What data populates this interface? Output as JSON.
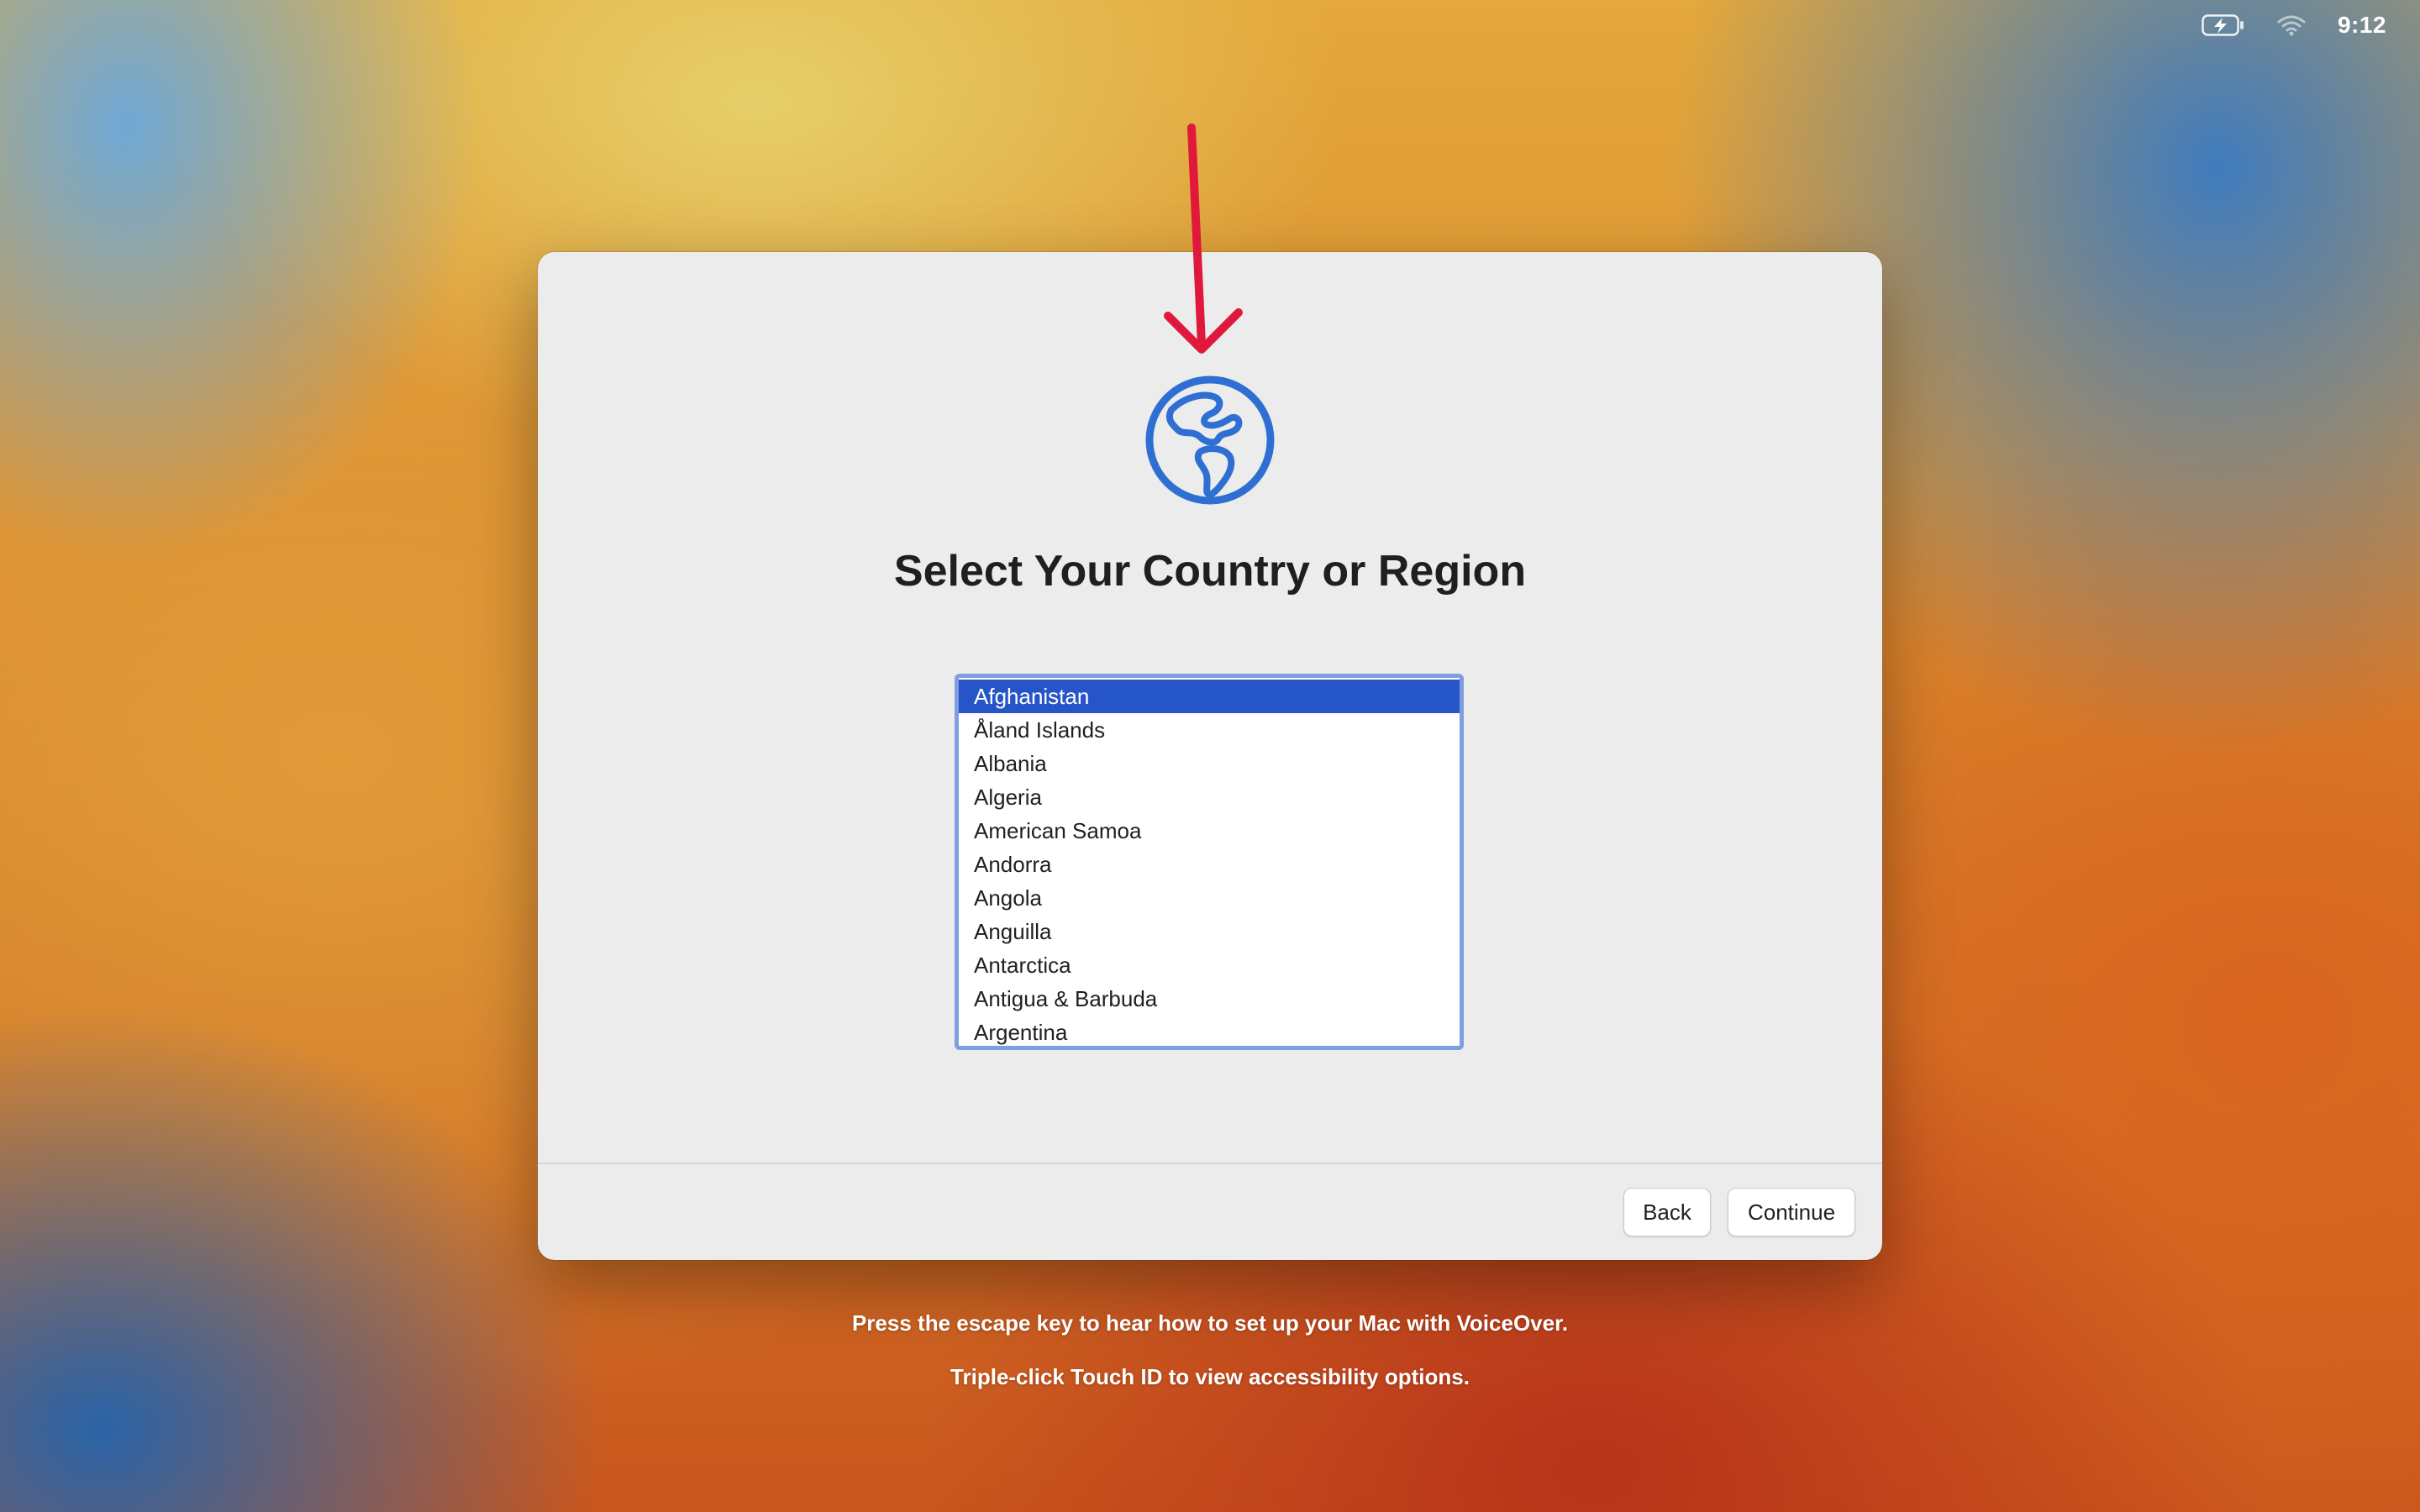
{
  "status_bar": {
    "battery_icon": "battery-charging-icon",
    "wifi_icon": "wifi-icon",
    "time": "9:12"
  },
  "setup_window": {
    "icon": "globe-icon",
    "accent_color": "#2f6fd3",
    "title": "Select Your Country or Region",
    "countries": [
      "Afghanistan",
      "Åland Islands",
      "Albania",
      "Algeria",
      "American Samoa",
      "Andorra",
      "Angola",
      "Anguilla",
      "Antarctica",
      "Antigua & Barbuda",
      "Argentina"
    ],
    "selected_country": "Afghanistan",
    "back_label": "Back",
    "continue_label": "Continue"
  },
  "annotation": {
    "type": "arrow",
    "color": "#e0193c",
    "target": "globe-icon"
  },
  "hints": {
    "voiceover": "Press the escape key to hear how to set up your Mac with VoiceOver.",
    "accessibility": "Triple-click Touch ID to view accessibility options."
  }
}
